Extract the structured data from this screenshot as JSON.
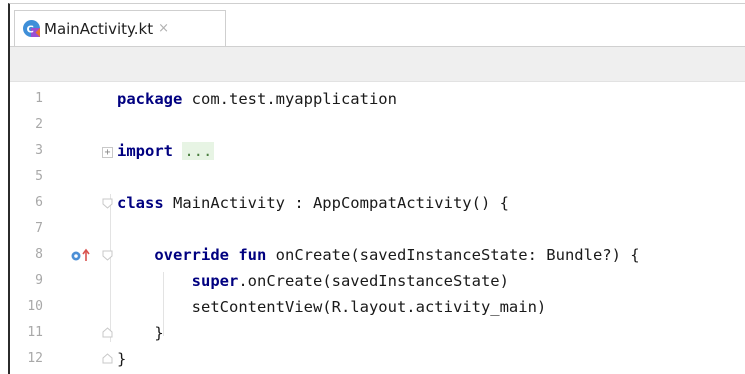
{
  "tabs": [
    {
      "label": "MainActivity.kt",
      "close": "×",
      "icon": "kotlin-file-icon"
    }
  ],
  "editor": {
    "lines": [
      {
        "num": "1",
        "code": "package com.test.myapplication"
      },
      {
        "num": "2",
        "code": ""
      },
      {
        "num": "3",
        "code": "import ..."
      },
      {
        "num": "5",
        "code": ""
      },
      {
        "num": "6",
        "code": "class MainActivity : AppCompatActivity() {"
      },
      {
        "num": "7",
        "code": ""
      },
      {
        "num": "8",
        "code": "    override fun onCreate(savedInstanceState: Bundle?) {"
      },
      {
        "num": "9",
        "code": "        super.onCreate(savedInstanceState)"
      },
      {
        "num": "10",
        "code": "        setContentView(R.layout.activity_main)"
      },
      {
        "num": "11",
        "code": "    }"
      },
      {
        "num": "12",
        "code": "}"
      }
    ],
    "gutter_icons": {
      "line_8": "override-method-icon"
    }
  },
  "colors": {
    "keyword": "#000080",
    "line_number": "#a8a8a8",
    "folded_region_bg": "#e7f4e4"
  }
}
